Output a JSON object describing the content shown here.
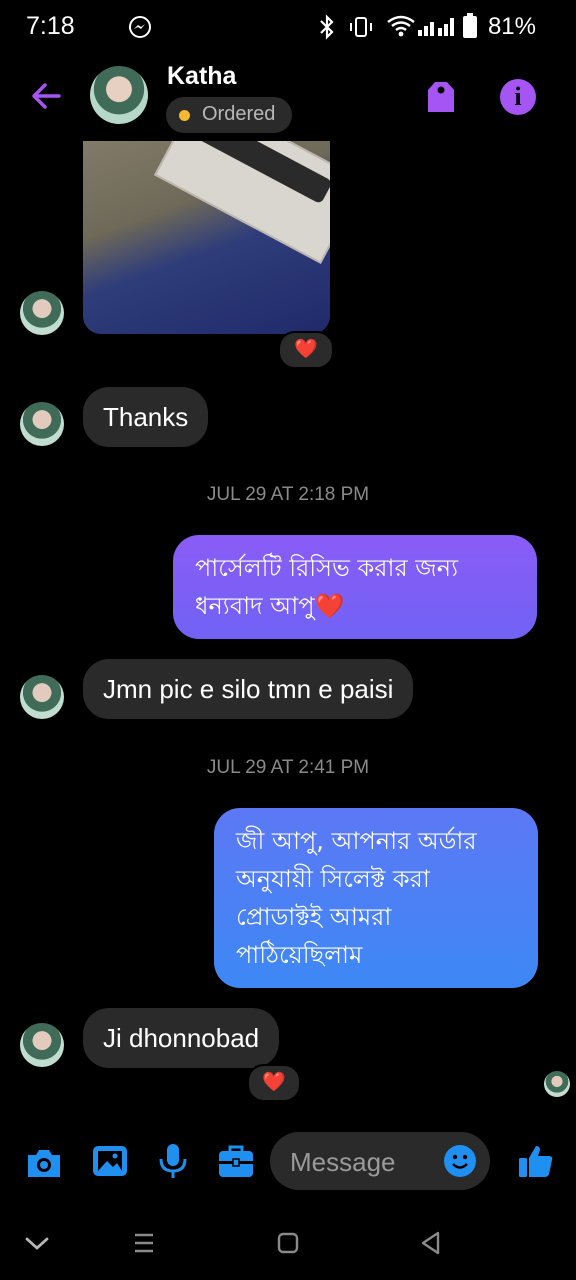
{
  "status_bar": {
    "time": "7:18",
    "battery": "81%"
  },
  "header": {
    "contact_name": "Katha",
    "status_label": "Ordered"
  },
  "messages": [
    {
      "type": "timestamp",
      "text": "JUL 29 AT 2:18 PM"
    },
    {
      "type": "timestamp",
      "text": "JUL 29 AT 2:41 PM"
    },
    {
      "type": "incoming",
      "text": "Thanks"
    },
    {
      "type": "outgoing",
      "text": "পার্সেলটি রিসিভ করার জন্য ধন্যবাদ আপু❤️"
    },
    {
      "type": "incoming",
      "text": "Jmn pic e silo tmn e paisi"
    },
    {
      "type": "outgoing",
      "text": "জী আপু, আপনার অর্ডার অনুযায়ী সিলেক্ট করা প্রোডাক্টই আমরা পাঠিয়েছিলাম"
    },
    {
      "type": "incoming",
      "text": "Ji dhonnobad"
    }
  ],
  "reactions": [
    "❤️",
    "❤️"
  ],
  "composer": {
    "placeholder": "Message"
  },
  "colors": {
    "accent": "#a655f5",
    "bubble_out_top": "#7d5cf5",
    "bubble_out_bottom": "#4a7df5",
    "icon_blue": "#1f8ff0"
  }
}
